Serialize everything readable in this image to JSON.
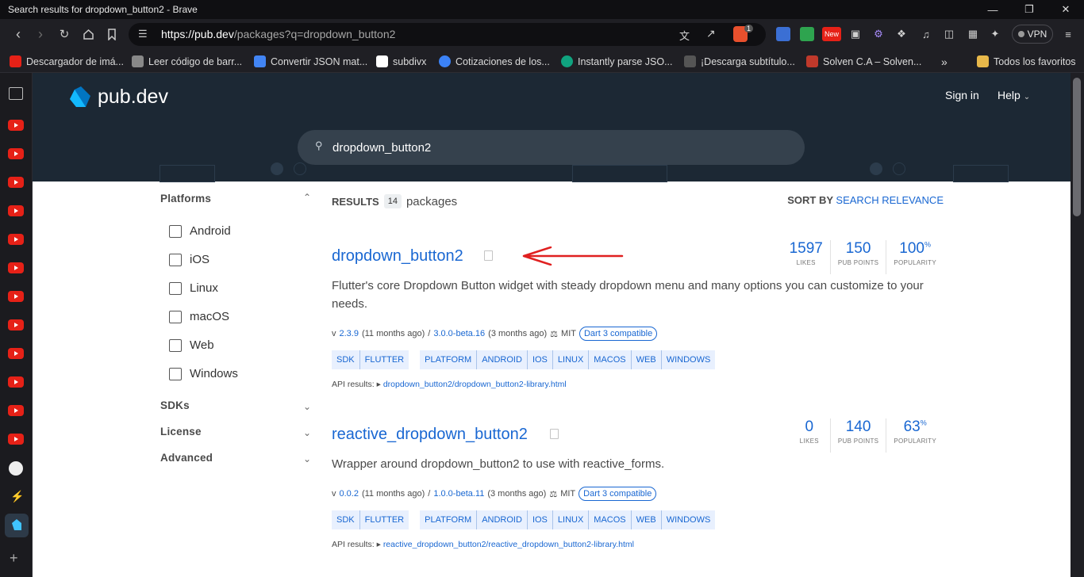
{
  "window": {
    "title": "Search results for dropdown_button2 - Brave",
    "minimize": "—",
    "restore": "❐",
    "close": "✕"
  },
  "browser": {
    "url_host": "https://pub.dev",
    "url_path": "/packages?q=dropdown_button2",
    "vpn_label": "VPN",
    "shield_count": "1",
    "new_badge": "New"
  },
  "bookmarks": [
    {
      "label": "Descargador de imá...",
      "color": "#e62117"
    },
    {
      "label": "Leer código de barr...",
      "color": "#888888"
    },
    {
      "label": "Convertir JSON mat...",
      "color": "#4285f4"
    },
    {
      "label": "subdivx",
      "color": "#ffffff"
    },
    {
      "label": "Cotizaciones de los...",
      "color": "#3b82f6"
    },
    {
      "label": "Instantly parse JSO...",
      "color": "#10a37f"
    },
    {
      "label": "¡Descarga subtítulo...",
      "color": "#555555"
    },
    {
      "label": "Solven C.A – Solven...",
      "color": "#c0392b"
    }
  ],
  "bookmarks_all": "Todos los favoritos",
  "header": {
    "logo_text": "pub.dev",
    "signin": "Sign in",
    "help": "Help"
  },
  "search": {
    "query": "dropdown_button2"
  },
  "filters": {
    "platforms_label": "Platforms",
    "platforms": [
      "Android",
      "iOS",
      "Linux",
      "macOS",
      "Web",
      "Windows"
    ],
    "sdks_label": "SDKs",
    "license_label": "License",
    "advanced_label": "Advanced"
  },
  "results": {
    "label": "RESULTS",
    "count": "14",
    "packages_word": "packages",
    "sort_label": "SORT BY",
    "sort_value": "SEARCH RELEVANCE"
  },
  "packages": [
    {
      "name": "dropdown_button2",
      "likes": "1597",
      "pub_points": "150",
      "popularity": "100",
      "likes_label": "LIKES",
      "points_label": "PUB POINTS",
      "popularity_label": "POPULARITY",
      "description": "Flutter's core Dropdown Button widget with steady dropdown menu and many options you can customize to your needs.",
      "v_prefix": "v",
      "version": "2.3.9",
      "version_age": "(11 months ago)",
      "sep": "/",
      "beta": "3.0.0-beta.16",
      "beta_age": "(3 months ago)",
      "license": "MIT",
      "dart3": "Dart 3 compatible",
      "sdk_tags": [
        "SDK",
        "FLUTTER"
      ],
      "platform_tags": [
        "PLATFORM",
        "ANDROID",
        "IOS",
        "LINUX",
        "MACOS",
        "WEB",
        "WINDOWS"
      ],
      "api_label": "API results:",
      "api_link": "dropdown_button2/dropdown_button2-library.html"
    },
    {
      "name": "reactive_dropdown_button2",
      "likes": "0",
      "pub_points": "140",
      "popularity": "63",
      "likes_label": "LIKES",
      "points_label": "PUB POINTS",
      "popularity_label": "POPULARITY",
      "description": "Wrapper around dropdown_button2 to use with reactive_forms.",
      "v_prefix": "v",
      "version": "0.0.2",
      "version_age": "(11 months ago)",
      "sep": "/",
      "beta": "1.0.0-beta.11",
      "beta_age": "(3 months ago)",
      "license": "MIT",
      "dart3": "Dart 3 compatible",
      "sdk_tags": [
        "SDK",
        "FLUTTER"
      ],
      "platform_tags": [
        "PLATFORM",
        "ANDROID",
        "IOS",
        "LINUX",
        "MACOS",
        "WEB",
        "WINDOWS"
      ],
      "api_label": "API results:",
      "api_link": "reactive_dropdown_button2/reactive_dropdown_button2-library.html"
    }
  ],
  "colors": {
    "accent": "#1967d2",
    "header_bg": "#1c2834",
    "annotation_arrow": "#e02020"
  }
}
